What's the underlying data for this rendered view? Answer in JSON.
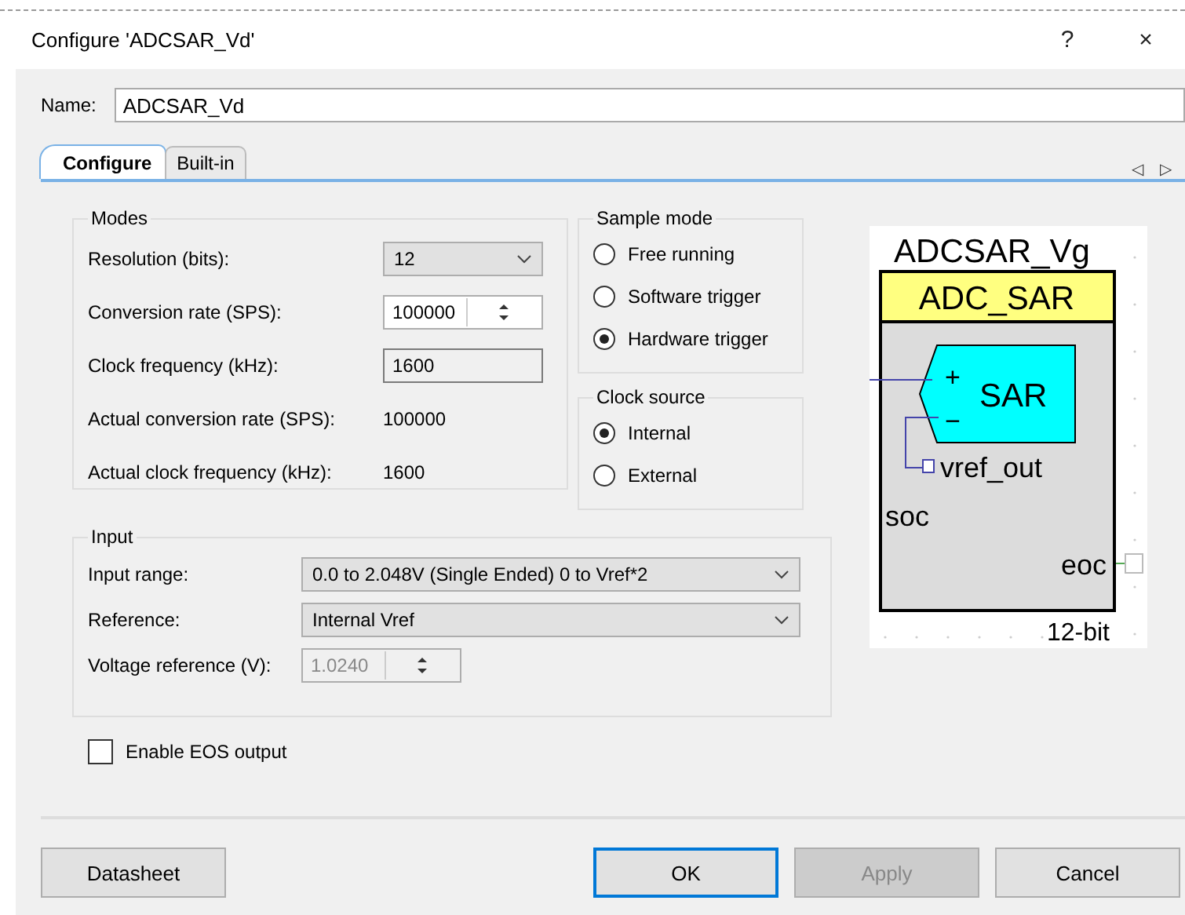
{
  "window": {
    "title": "Configure 'ADCSAR_Vd'",
    "help": "?",
    "close": "×"
  },
  "name_field": {
    "label": "Name:",
    "value": "ADCSAR_Vd"
  },
  "tabs": [
    {
      "label": "Configure",
      "selected": true
    },
    {
      "label": "Built-in",
      "selected": false
    }
  ],
  "tab_scroll": {
    "left": "◁",
    "right": "▷"
  },
  "modes": {
    "title": "Modes",
    "rows": [
      {
        "kind": "dropdown",
        "label": "Resolution (bits):",
        "value": "12"
      },
      {
        "kind": "spinner",
        "label": "Conversion rate (SPS):",
        "value": "100000"
      },
      {
        "kind": "textbox",
        "label": "Clock frequency (kHz):",
        "value": "1600"
      },
      {
        "kind": "readout",
        "label": "Actual conversion rate (SPS):",
        "value": "100000"
      },
      {
        "kind": "readout",
        "label": "Actual clock frequency (kHz):",
        "value": "1600"
      }
    ]
  },
  "sample_mode": {
    "title": "Sample mode",
    "options": [
      {
        "label": "Free running",
        "selected": false
      },
      {
        "label": "Software trigger",
        "selected": false
      },
      {
        "label": "Hardware trigger",
        "selected": true
      }
    ]
  },
  "clock_source": {
    "title": "Clock source",
    "options": [
      {
        "label": "Internal",
        "selected": true
      },
      {
        "label": "External",
        "selected": false
      }
    ]
  },
  "input": {
    "title": "Input",
    "rows": [
      {
        "kind": "dropdown",
        "label": "Input range:",
        "value": "0.0 to 2.048V (Single Ended) 0 to Vref*2",
        "disabled": false
      },
      {
        "kind": "dropdown",
        "label": "Reference:",
        "value": "Internal Vref",
        "disabled": false
      },
      {
        "kind": "spinner",
        "label": "Voltage reference (V):",
        "value": "1.0240",
        "disabled": true
      }
    ]
  },
  "eos": {
    "label": "Enable EOS output",
    "checked": false
  },
  "symbol": {
    "instance": "ADCSAR_Vg",
    "component": "ADC_SAR",
    "plus": "+",
    "block": "SAR",
    "minus": "−",
    "vref": "vref_out",
    "soc": "soc",
    "eoc": "eoc",
    "resolution": "12-bit"
  },
  "buttons": [
    {
      "label": "Datasheet",
      "kind": "left",
      "disabled": false
    },
    {
      "label": "OK",
      "kind": "default",
      "disabled": false
    },
    {
      "label": "Apply",
      "kind": "normal",
      "disabled": true
    },
    {
      "label": "Cancel",
      "kind": "normal",
      "disabled": false
    }
  ]
}
